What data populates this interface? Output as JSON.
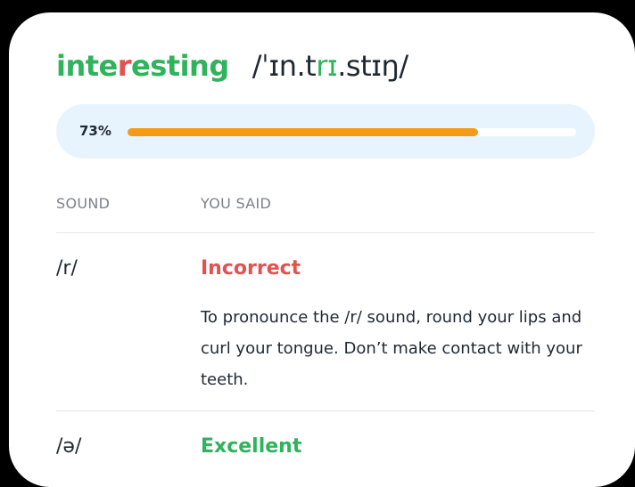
{
  "word": {
    "p1": "inte",
    "p2": "r",
    "p3": "esting",
    "ipa_a": "/ˈɪn.t",
    "ipa_b": "rɪ",
    "ipa_c": ".stɪŋ/"
  },
  "progress": {
    "label": "73%",
    "value": 0.73
  },
  "table": {
    "col_sound": "SOUND",
    "col_said": "YOU SAID",
    "rows": [
      {
        "sound": "/r/",
        "result": "Incorrect",
        "tip": "To pronounce the /r/ sound, round your lips and curl your tongue. Don’t make contact with your teeth."
      },
      {
        "sound": "/ə/",
        "result": "Excellent"
      }
    ]
  },
  "colors": {
    "correct": "#2fb35b",
    "incorrect": "#e2524f",
    "progress": "#f59a14",
    "progress_bg": "#e8f4fd"
  }
}
